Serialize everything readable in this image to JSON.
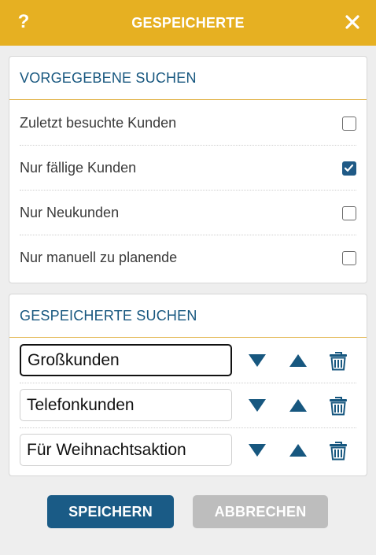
{
  "header": {
    "help_label": "?",
    "title": "GESPEICHERTE"
  },
  "predefined": {
    "title": "VORGEGEBENE SUCHEN",
    "items": [
      {
        "label": "Zuletzt besuchte Kunden",
        "checked": false
      },
      {
        "label": "Nur fällige Kunden",
        "checked": true
      },
      {
        "label": "Nur Neukunden",
        "checked": false
      },
      {
        "label": "Nur manuell zu planende",
        "checked": false
      }
    ]
  },
  "saved": {
    "title": "GESPEICHERTE SUCHEN",
    "items": [
      {
        "value": "Großkunden",
        "focused": true
      },
      {
        "value": "Telefonkunden",
        "focused": false
      },
      {
        "value": "Für Weihnachtsaktion",
        "focused": false
      }
    ]
  },
  "footer": {
    "save_label": "SPEICHERN",
    "cancel_label": "ABBRECHEN"
  },
  "colors": {
    "header": "#e6b022",
    "accent": "#1a5b86",
    "disabled": "#bdbdbd",
    "section_title": "#17577f"
  }
}
